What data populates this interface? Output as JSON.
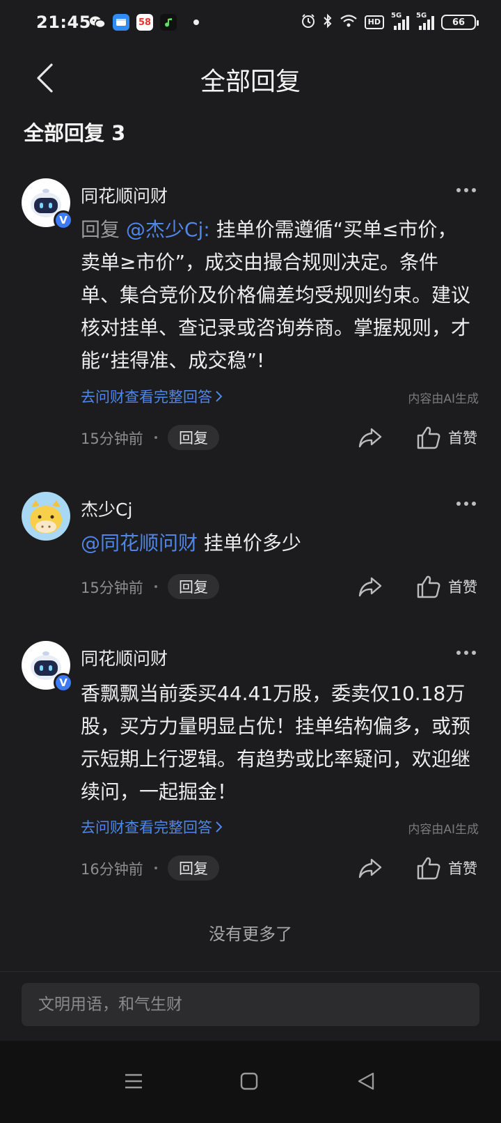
{
  "status_bar": {
    "time": "21:45",
    "apps": [
      "wechat-icon",
      "browser-icon",
      "58-icon",
      "music-icon"
    ],
    "app_58_label": "58",
    "network_label_1": "5G",
    "network_label_2": "5G",
    "hd_label": "HD",
    "battery": "66"
  },
  "nav": {
    "title": "全部回复"
  },
  "section": {
    "title": "全部回复 3"
  },
  "comments": [
    {
      "user": "同花顺问财",
      "verified": true,
      "verify_mark": "V",
      "reply_prefix": "回复",
      "mention": "@杰少Cj:",
      "text": "挂单价需遵循“买单≤市价，卖单≥市价”，成交由撮合规则决定。条件单、集合竞价及价格偏差均受规则约束。建议核对挂单、查记录或咨询券商。掌握规则，才能“挂得准、成交稳”!",
      "more_link": "去问财查看完整回答",
      "ai_note": "内容由AI生成",
      "time": "15分钟前",
      "reply_label": "回复",
      "like_label": "首赞"
    },
    {
      "user": "杰少Cj",
      "verified": false,
      "mention": "@同花顺问财",
      "text": "挂单价多少",
      "time": "15分钟前",
      "reply_label": "回复",
      "like_label": "首赞"
    },
    {
      "user": "同花顺问财",
      "verified": true,
      "verify_mark": "V",
      "text": "香飘飘当前委买44.41万股，委卖仅10.18万股，买方力量明显占优！挂单结构偏多，或预示短期上行逻辑。有趋势或比率疑问，欢迎继续问，一起掘金！",
      "more_link": "去问财查看完整回答",
      "ai_note": "内容由AI生成",
      "time": "16分钟前",
      "reply_label": "回复",
      "like_label": "首赞"
    }
  ],
  "footer": {
    "no_more": "没有更多了"
  },
  "input": {
    "placeholder": "文明用语，和气生财"
  },
  "colors": {
    "background": "#1c1c1e",
    "accent": "#4f86e8",
    "verify_badge": "#3e7bf2"
  }
}
